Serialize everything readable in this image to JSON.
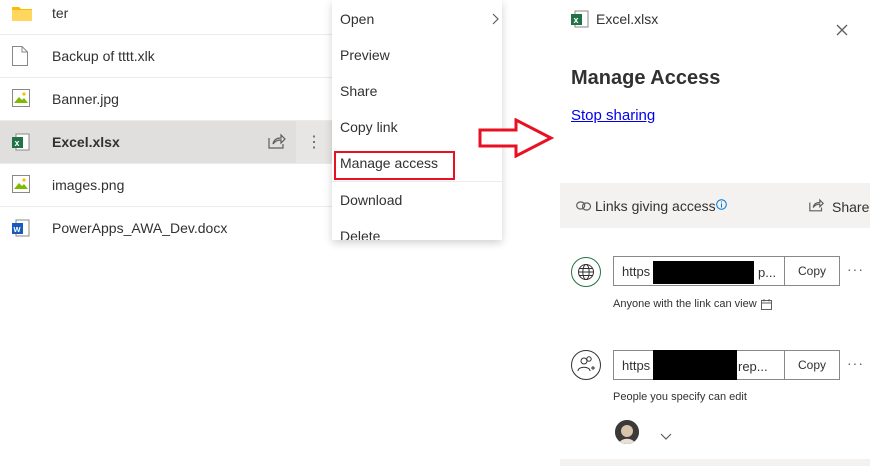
{
  "files": [
    {
      "name": "ter",
      "icon": "folder-icon",
      "selected": false
    },
    {
      "name": "Backup of tttt.xlk",
      "icon": "generic-file-icon",
      "selected": false
    },
    {
      "name": "Banner.jpg",
      "icon": "image-file-icon",
      "selected": false
    },
    {
      "name": "Excel.xlsx",
      "icon": "excel-file-icon",
      "selected": true
    },
    {
      "name": "images.png",
      "icon": "image-file-icon",
      "selected": false
    },
    {
      "name": "PowerApps_AWA_Dev.docx",
      "icon": "word-file-icon",
      "selected": false
    }
  ],
  "context_menu": {
    "items": [
      {
        "label": "Open",
        "has_submenu": true
      },
      {
        "label": "Preview"
      },
      {
        "label": "Share"
      },
      {
        "label": "Copy link"
      },
      {
        "label": "Manage access",
        "highlighted": true
      },
      {
        "label": "Download"
      },
      {
        "label": "Delete"
      }
    ]
  },
  "panel": {
    "file_name": "Excel.xlsx",
    "title": "Manage Access",
    "stop_sharing": "Stop sharing",
    "links_header": "Links giving access",
    "share_label": "Share",
    "links": [
      {
        "url_prefix": "https",
        "url_suffix": "p...",
        "copy_label": "Copy",
        "description": "Anyone with the link can view",
        "icon": "globe-icon"
      },
      {
        "url_prefix": "https",
        "url_suffix": "rep...",
        "copy_label": "Copy",
        "description": "People you specify can edit",
        "icon": "people-icon"
      }
    ]
  },
  "colors": {
    "accent_red": "#e81123",
    "link_blue": "#0000ee",
    "excel_green": "#217346",
    "word_blue": "#185abd",
    "selected_row": "#e1dfdd"
  }
}
